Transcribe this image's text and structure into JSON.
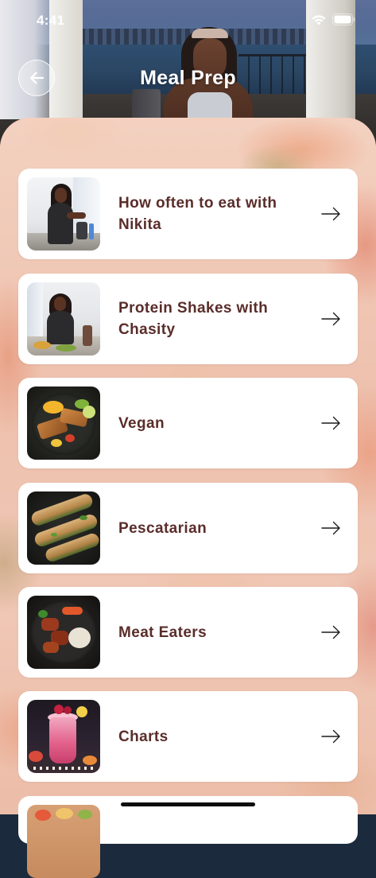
{
  "status_bar": {
    "time": "4:41"
  },
  "header": {
    "title": "Meal Prep"
  },
  "items": [
    {
      "title": "How often to eat with Nikita"
    },
    {
      "title": "Protein Shakes with Chasity"
    },
    {
      "title": "Vegan"
    },
    {
      "title": "Pescatarian"
    },
    {
      "title": "Meat Eaters"
    },
    {
      "title": "Charts"
    }
  ],
  "colors": {
    "item_title": "#5a2d2a",
    "card_background": "#ffffff",
    "header_text": "#ffffff"
  },
  "icons": {
    "back": "arrow-left-icon",
    "item_action": "arrow-right-icon",
    "status": [
      "wifi-icon",
      "battery-icon"
    ]
  }
}
